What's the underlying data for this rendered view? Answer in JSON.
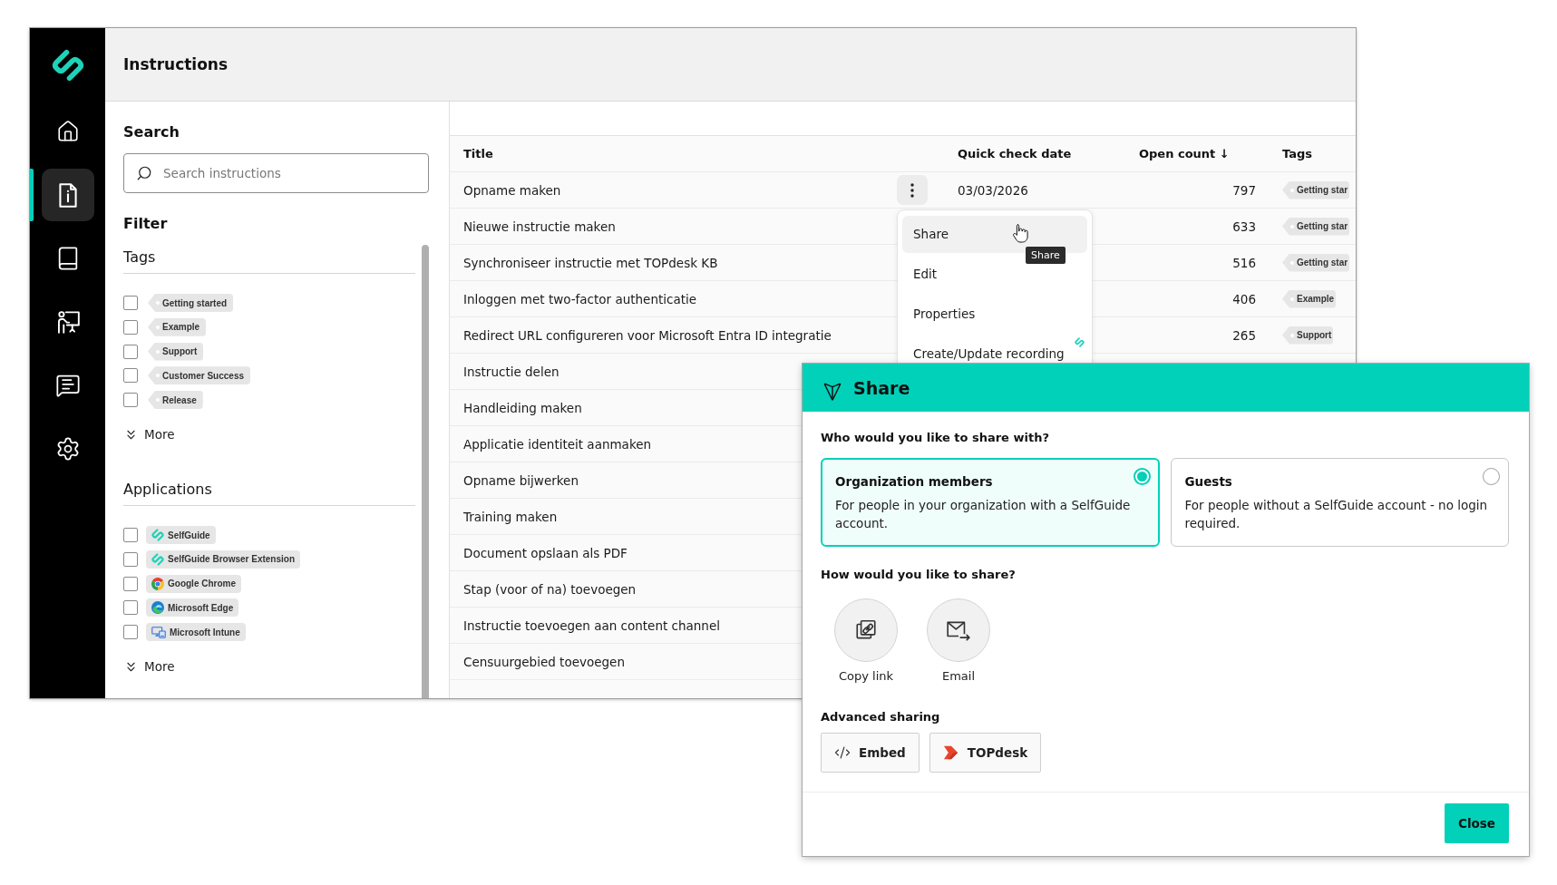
{
  "app": {
    "title": "Instructions"
  },
  "sidebar": {
    "items": [
      {
        "selected": false
      },
      {
        "selected": true
      },
      {
        "selected": false
      },
      {
        "selected": false
      },
      {
        "selected": false
      },
      {
        "selected": false
      }
    ]
  },
  "search": {
    "heading": "Search",
    "placeholder": "Search instructions"
  },
  "filters": {
    "heading": "Filter",
    "groups": [
      {
        "kind": "tags",
        "heading": "Tags",
        "items": [
          {
            "label": "Getting started",
            "checked": false
          },
          {
            "label": "Example",
            "checked": false
          },
          {
            "label": "Support",
            "checked": false
          },
          {
            "label": "Customer Success",
            "checked": false
          },
          {
            "label": "Release",
            "checked": false
          }
        ],
        "more": "More"
      },
      {
        "kind": "applications",
        "heading": "Applications",
        "items": [
          {
            "label": "SelfGuide",
            "checked": false
          },
          {
            "label": "SelfGuide Browser Extension",
            "checked": false
          },
          {
            "label": "Google Chrome",
            "checked": false
          },
          {
            "label": "Microsoft Edge",
            "checked": false
          },
          {
            "label": "Microsoft Intune",
            "checked": false
          }
        ],
        "more": "More"
      }
    ]
  },
  "table": {
    "columns": [
      {
        "label": "Title"
      },
      {
        "label": "Quick check date"
      },
      {
        "label": "Open count ↓"
      },
      {
        "label": "Tags"
      }
    ],
    "rows": [
      {
        "title": "Opname maken",
        "quick_check_date": "03/03/2026",
        "open_count": "797",
        "tags": [
          "Getting star"
        ],
        "menu_open": true
      },
      {
        "title": "Nieuwe instructie maken",
        "open_count": "633",
        "tags": [
          "Getting star"
        ],
        "menu_open": false
      },
      {
        "title": "Synchroniseer instructie met TOPdesk KB",
        "open_count": "516",
        "tags": [
          "Getting star"
        ],
        "menu_open": false
      },
      {
        "title": "Inloggen met two-factor authenticatie",
        "open_count": "406",
        "tags": [
          "Example"
        ],
        "menu_open": false
      },
      {
        "title": "Redirect URL configureren voor Microsoft Entra ID integratie",
        "open_count": "265",
        "tags": [
          "Support"
        ],
        "menu_open": false
      },
      {
        "title": "Instructie delen"
      },
      {
        "title": "Handleiding maken"
      },
      {
        "title": "Applicatie identiteit aanmaken"
      },
      {
        "title": "Opname bijwerken"
      },
      {
        "title": "Training maken"
      },
      {
        "title": "Document opslaan als PDF"
      },
      {
        "title": "Stap (voor of na) toevoegen"
      },
      {
        "title": "Instructie toevoegen aan content channel"
      },
      {
        "title": "Censuurgebied toevoegen"
      }
    ]
  },
  "row_menu": {
    "items": [
      {
        "label": "Share",
        "hovered": true,
        "app_badge": false
      },
      {
        "label": "Edit",
        "hovered": false,
        "app_badge": false
      },
      {
        "label": "Properties",
        "hovered": false,
        "app_badge": false
      },
      {
        "label": "Create/Update recording",
        "hovered": false,
        "app_badge": true
      }
    ],
    "tooltip": "Share"
  },
  "share_dialog": {
    "title": "Share",
    "audience_heading": "Who would you like to share with?",
    "audience_options": [
      {
        "title": "Organization members",
        "description": "For people in your organization with a SelfGuide account.",
        "selected": true
      },
      {
        "title": "Guests",
        "description": "For people without a SelfGuide account - no login required.",
        "selected": false
      }
    ],
    "method_heading": "How would you like to share?",
    "methods": [
      {
        "label": "Copy link"
      },
      {
        "label": "Email"
      }
    ],
    "advanced_heading": "Advanced sharing",
    "advanced_buttons": [
      {
        "label": "Embed"
      },
      {
        "label": "TOPdesk"
      }
    ],
    "close_button": "Close"
  }
}
